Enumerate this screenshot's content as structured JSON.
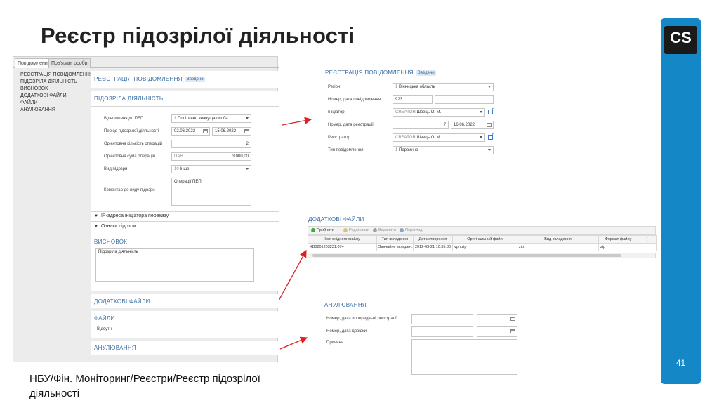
{
  "slide": {
    "title": "Реєстр підозрілої діяльності",
    "logo": "CS",
    "page_number": "41",
    "footer_path": "НБУ/Фін. Моніторинг/Реєстри/Реєстр підозрілої діяльності"
  },
  "tabs": [
    "Повідомлення",
    "Пов'язані особи"
  ],
  "nav": [
    "Реєстрація повідомлення",
    "Підозріла діяльність",
    "Висновок",
    "Додаткові файли",
    "Файли",
    "Анулювання"
  ],
  "left": {
    "registration": {
      "title": "Реєстрація повідомлення",
      "status": "Введено"
    },
    "suspicious": {
      "title": "Підозріла діяльність",
      "pep_label": "Відношення до ПЕП",
      "pep_code": "1",
      "pep_value": "Політично значуща особа",
      "period_label": "Період підозрілої діяльності",
      "period_from": "02.06.2022",
      "period_to": "15.06.2022",
      "ops_count_label": "Орієнтовна кількість операцій",
      "ops_count": "2",
      "sum_label": "Орієнтовна сума операцій",
      "currency": "UAH",
      "sum": "3 000,00",
      "type_label": "Вид підозри",
      "type_code": "10",
      "type_value": "Інше",
      "comment_label": "Коментар до виду підозри",
      "comment": "Операції ПЕП",
      "ip_section": "IP-адреса ініціатора переказу",
      "signs_section": "Ознаки підозри"
    },
    "conclusion": {
      "title": "Висновок",
      "text": "Підозріла діяльність"
    },
    "additional_files": {
      "title": "Додаткові файли"
    },
    "files": {
      "title": "Файли",
      "text": "Відсутні"
    },
    "cancellation": {
      "title": "Анулювання"
    }
  },
  "registration_detail": {
    "title": "Реєстрація повідомлення",
    "status": "Введено",
    "region_label": "Регіон",
    "region_code": "1",
    "region_value": "Вінницька область",
    "msg_label": "Номер, дата повідомлення",
    "msg_number": "923",
    "initiator_label": "Ініціатор",
    "initiator_prefix": "CREATOR",
    "initiator_value": "Швець О. М.",
    "reg_label": "Номер, дата реєстрації",
    "reg_number": "7",
    "reg_date": "16.06.2022",
    "registrar_label": "Реєстратор",
    "registrar_prefix": "CREATOR",
    "registrar_value": "Швець О. М.",
    "type_label": "Тип повідомлення",
    "type_code": "1",
    "type_value": "Первинне"
  },
  "files_grid": {
    "title": "Додаткові файли",
    "toolbar": [
      "Прийняти",
      "Редагувати",
      "Видалити",
      "Перегляд"
    ],
    "columns": [
      "Ім'я вхідного файлу",
      "Тип вкладення",
      "Дата створення",
      "Оригінальний файл",
      "Вид вкладення",
      "Формат файлу",
      "("
    ],
    "rows": [
      [
        "XB0201203231.074",
        "Звичайне вкладен...",
        "2012-03-21 10:55:00",
        "vpn.zip",
        "zip",
        "zip",
        ""
      ]
    ]
  },
  "cancellation_detail": {
    "title": "Анулювання",
    "prev_label": "Номер, дата попередньої реєстрації",
    "cert_label": "Номер, дата довідки",
    "reason_label": "Причина"
  },
  "colors": {
    "accent_bar": "#1487c6",
    "section_heading": "#3a6ea5",
    "arrow": "#e02020"
  }
}
